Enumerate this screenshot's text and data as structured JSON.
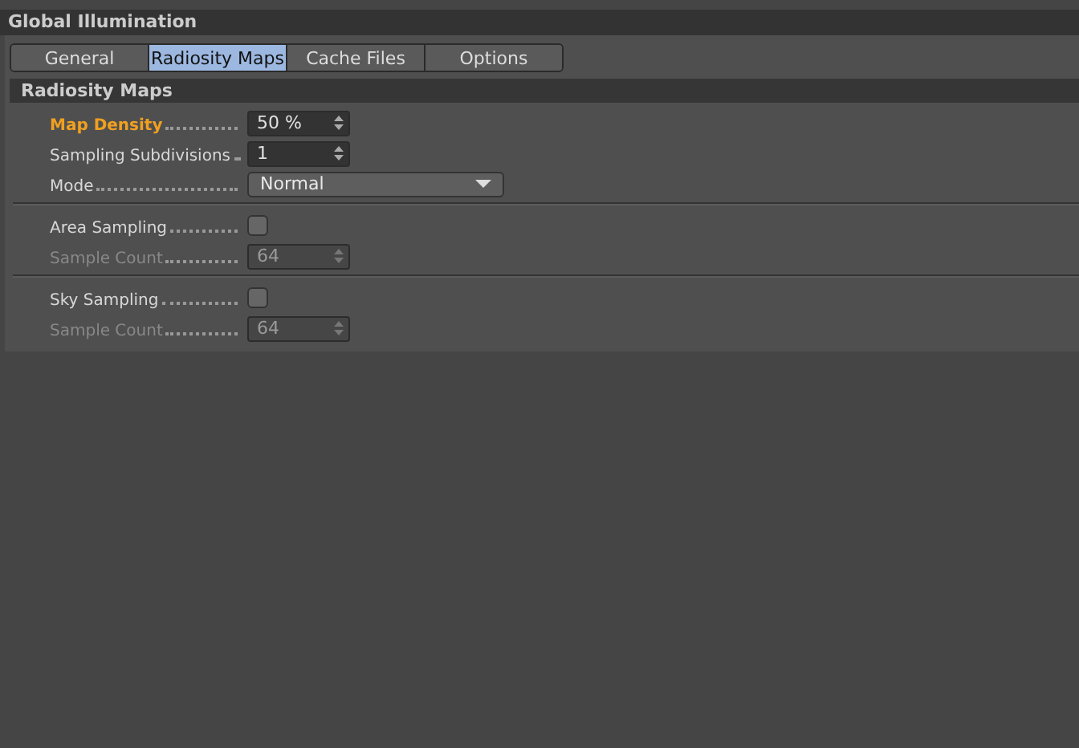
{
  "title": "Global Illumination",
  "tabs": [
    {
      "label": "General",
      "selected": false
    },
    {
      "label": "Radiosity Maps",
      "selected": true
    },
    {
      "label": "Cache Files",
      "selected": false
    },
    {
      "label": "Options",
      "selected": false
    }
  ],
  "section": "Radiosity Maps",
  "groups": [
    {
      "rows": [
        {
          "kind": "number",
          "label": "Map Density",
          "value": "50 %",
          "highlighted": true,
          "disabled": false
        },
        {
          "kind": "number",
          "label": "Sampling Subdivisions",
          "value": "1",
          "highlighted": false,
          "disabled": false
        },
        {
          "kind": "dropdown",
          "label": "Mode",
          "value": "Normal",
          "highlighted": false,
          "disabled": false
        }
      ]
    },
    {
      "rows": [
        {
          "kind": "checkbox",
          "label": "Area Sampling",
          "checked": false,
          "highlighted": false,
          "disabled": false
        },
        {
          "kind": "number",
          "label": "Sample Count",
          "value": "64",
          "highlighted": false,
          "disabled": true
        }
      ]
    },
    {
      "rows": [
        {
          "kind": "checkbox",
          "label": "Sky Sampling",
          "checked": false,
          "highlighted": false,
          "disabled": false
        },
        {
          "kind": "number",
          "label": "Sample Count",
          "value": "64",
          "highlighted": false,
          "disabled": true
        }
      ]
    }
  ]
}
